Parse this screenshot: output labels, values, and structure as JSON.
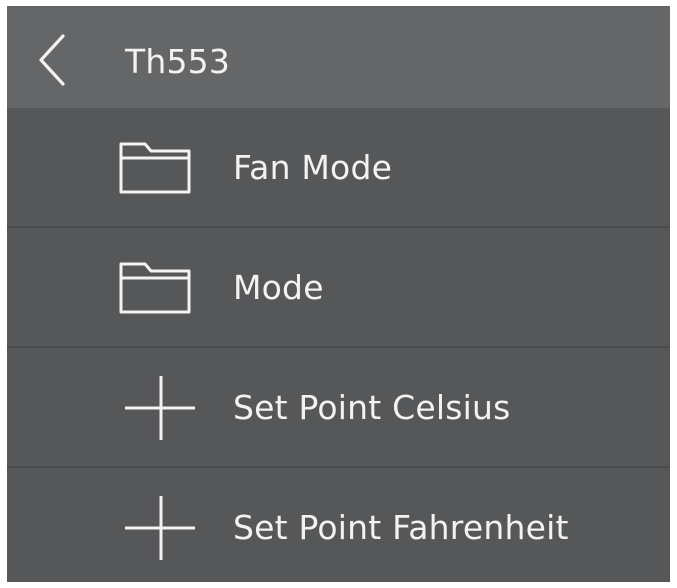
{
  "header": {
    "back_icon": "chevron-left-icon",
    "title": "Th553"
  },
  "items": [
    {
      "label": "Fan Mode",
      "icon": "folder-icon"
    },
    {
      "label": "Mode",
      "icon": "folder-icon"
    },
    {
      "label": "Set Point Celsius",
      "icon": "plus-icon"
    },
    {
      "label": "Set Point Fahrenheit",
      "icon": "plus-icon"
    }
  ],
  "colors": {
    "header_bg": "#646668",
    "list_bg": "#555759",
    "divider": "#4a4c4e",
    "text": "#f2f2f2"
  }
}
